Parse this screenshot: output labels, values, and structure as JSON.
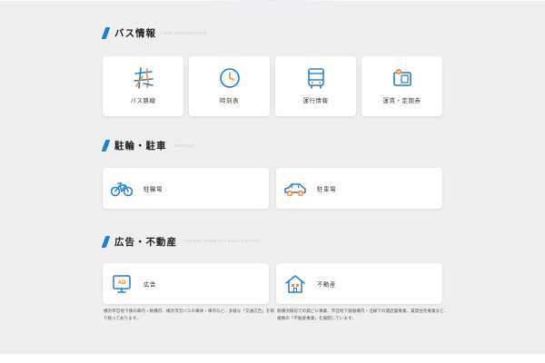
{
  "sections": {
    "bus": {
      "title": "バス情報",
      "subtitle": "BUS INFORMATION"
    },
    "parking": {
      "title": "駐輪・駐車",
      "subtitle": "PARKING"
    },
    "ad": {
      "title": "広告・不動産",
      "subtitle": "ADVERTISEMENT・REAL ESTATE"
    }
  },
  "bus_cards": [
    {
      "label": "バス路線",
      "icon": "bus-route-map-icon"
    },
    {
      "label": "時刻表",
      "icon": "clock-icon"
    },
    {
      "label": "運行情報",
      "icon": "bus-icon"
    },
    {
      "label": "運賃・定期券",
      "icon": "fare-pass-card-icon"
    }
  ],
  "parking_cards": [
    {
      "label": "駐輪場",
      "icon": "bicycle-icon"
    },
    {
      "label": "駐車場",
      "icon": "car-icon"
    }
  ],
  "ad_cards": [
    {
      "label": "広告",
      "icon": "ad-display-icon",
      "badge": "AD",
      "desc": "横浜市営地下鉄の車内・駅構内、横浜市営バスの車体・車内など、多様な「交通広告」を取り扱っております。"
    },
    {
      "label": "不動産",
      "icon": "house-icon",
      "desc": "新横浜駅前での貸ビル事業、市営地下鉄駅構内・沿線での貸店舗事業、賃貸住宅事業など、複数の「不動産事業」を展開しています。"
    }
  ],
  "colors": {
    "accent": "#1f7fd6",
    "orange": "#f08a2c",
    "background": "#efeff1",
    "card": "#ffffff"
  }
}
